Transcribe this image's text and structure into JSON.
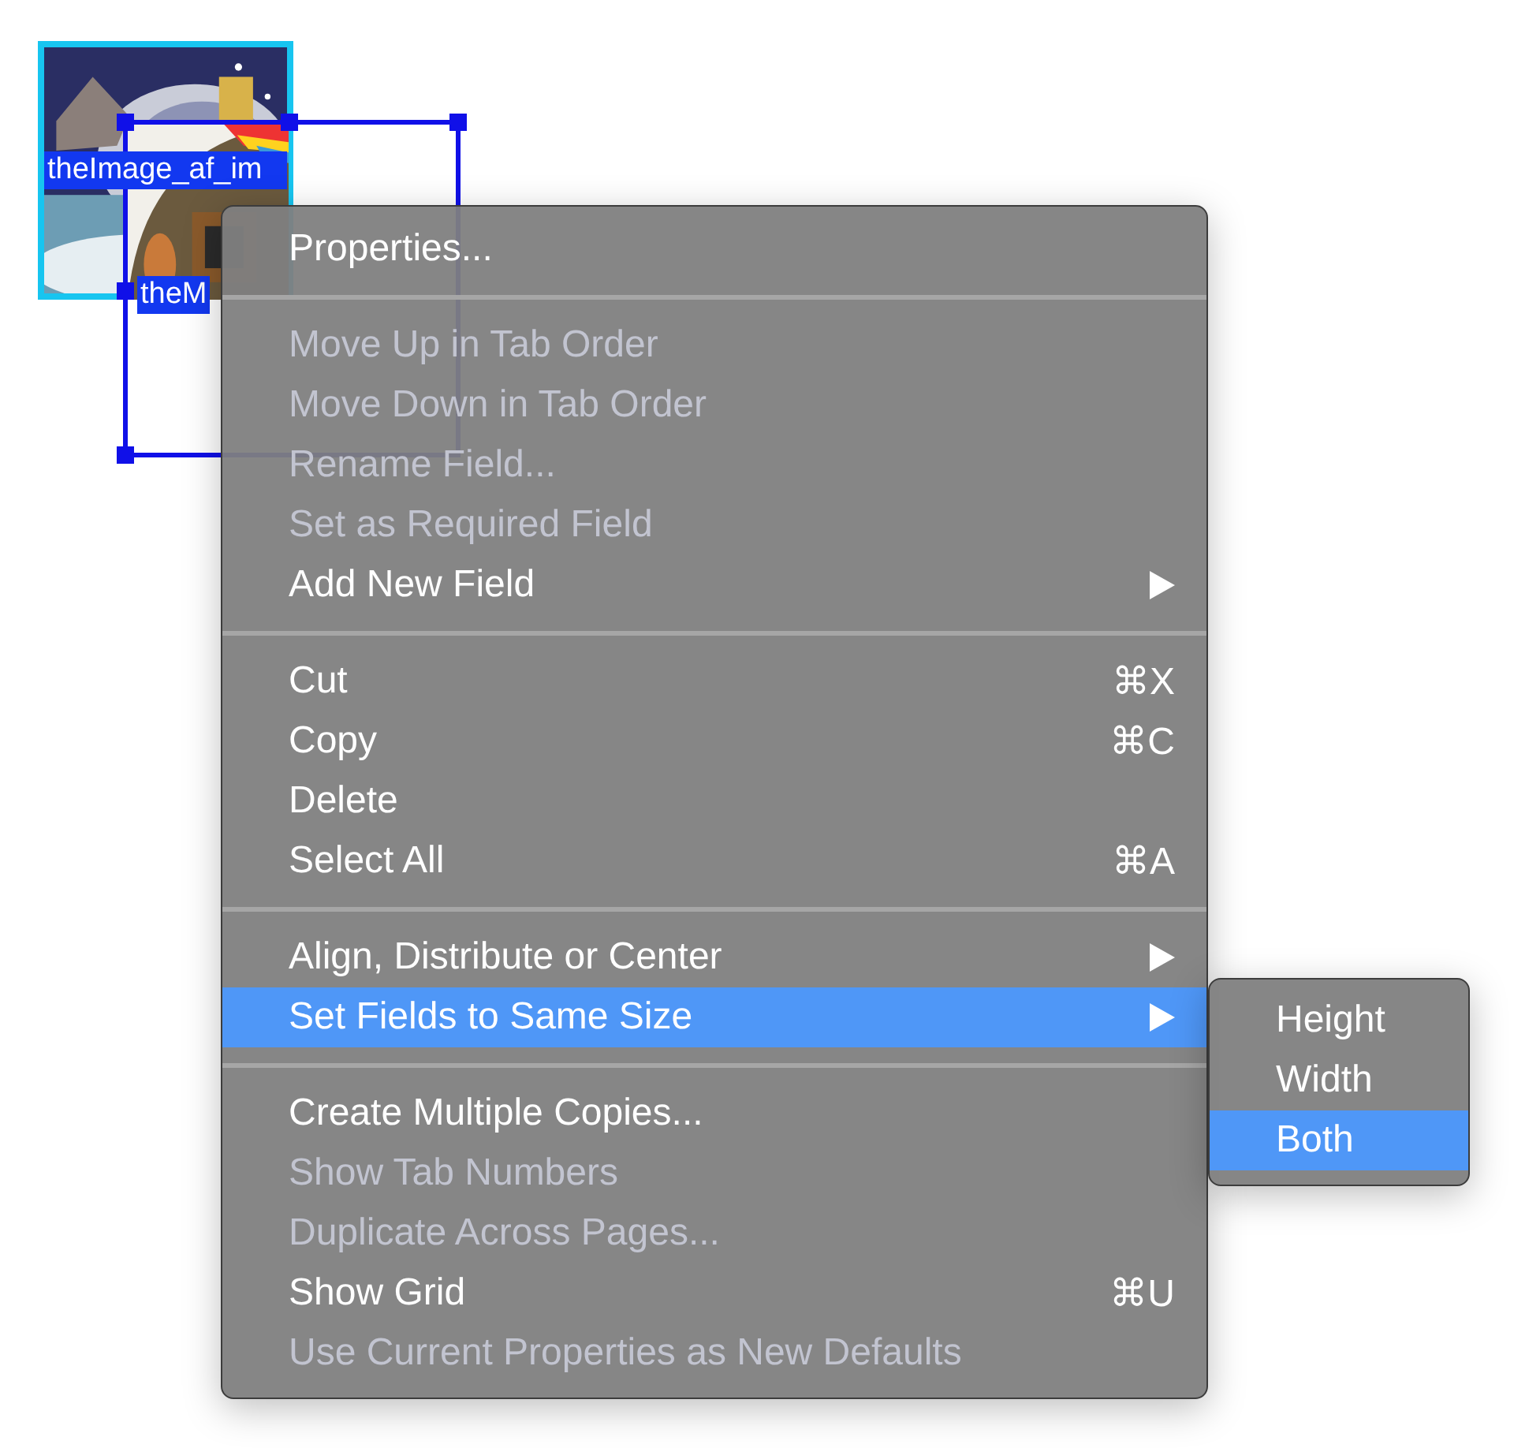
{
  "canvas": {
    "fields": [
      {
        "label": "theImage_af_im",
        "selected": false
      },
      {
        "label": "theM",
        "selected": true
      }
    ]
  },
  "context_menu": {
    "sections": [
      [
        {
          "label": "Properties...",
          "disabled": false,
          "submenu": false,
          "selected": false
        }
      ],
      [
        {
          "label": "Move Up in Tab Order",
          "disabled": true,
          "submenu": false,
          "selected": false
        },
        {
          "label": "Move Down in Tab Order",
          "disabled": true,
          "submenu": false,
          "selected": false
        },
        {
          "label": "Rename Field...",
          "disabled": true,
          "submenu": false,
          "selected": false
        },
        {
          "label": "Set as Required Field",
          "disabled": true,
          "submenu": false,
          "selected": false
        },
        {
          "label": "Add New Field",
          "disabled": false,
          "submenu": true,
          "selected": false
        }
      ],
      [
        {
          "label": "Cut",
          "shortcut": "⌘X",
          "disabled": false,
          "submenu": false,
          "selected": false
        },
        {
          "label": "Copy",
          "shortcut": "⌘C",
          "disabled": false,
          "submenu": false,
          "selected": false
        },
        {
          "label": "Delete",
          "disabled": false,
          "submenu": false,
          "selected": false
        },
        {
          "label": "Select All",
          "shortcut": "⌘A",
          "disabled": false,
          "submenu": false,
          "selected": false
        }
      ],
      [
        {
          "label": "Align, Distribute or Center",
          "disabled": false,
          "submenu": true,
          "selected": false
        },
        {
          "label": "Set Fields to Same Size",
          "disabled": false,
          "submenu": true,
          "selected": true
        }
      ],
      [
        {
          "label": "Create Multiple Copies...",
          "disabled": false,
          "submenu": false,
          "selected": false
        },
        {
          "label": "Show Tab Numbers",
          "disabled": true,
          "submenu": false,
          "selected": false
        },
        {
          "label": "Duplicate Across Pages...",
          "disabled": true,
          "submenu": false,
          "selected": false
        },
        {
          "label": "Show Grid",
          "shortcut": "⌘U",
          "disabled": false,
          "submenu": false,
          "selected": false
        },
        {
          "label": "Use Current Properties as New Defaults",
          "disabled": true,
          "submenu": false,
          "selected": false
        }
      ]
    ]
  },
  "submenu": {
    "items": [
      {
        "label": "Height",
        "selected": false
      },
      {
        "label": "Width",
        "selected": false
      },
      {
        "label": "Both",
        "selected": true
      }
    ]
  }
}
